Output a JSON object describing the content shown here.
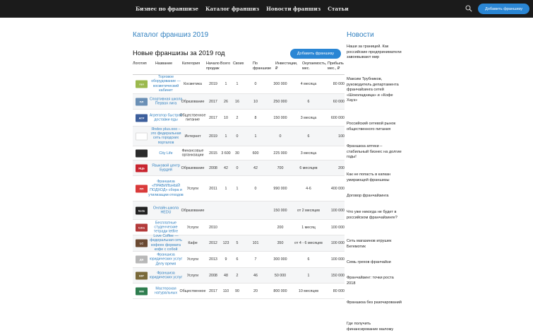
{
  "nav": {
    "links": [
      "Бизнес по франшизе",
      "Каталог франшиз",
      "Новости франшиз",
      "Статьи"
    ],
    "cta": "Добавить франшизу"
  },
  "page": {
    "title": "Каталог франшиз 2019",
    "section_title": "Новые франшизы за 2019 год",
    "add_button": "Добавить франшизу"
  },
  "table": {
    "headers": [
      "Логотип",
      "Название",
      "Категория",
      "Начало продаж",
      "Всего",
      "Своих",
      "По франшизе",
      "Инвестиции, ₽",
      "Окупаемость, мес.",
      "Прибыль мес., ₽"
    ],
    "rows": [
      {
        "logo": "гол",
        "logo_color": "#9bb94d",
        "name": "Торговое оборудование — косметический кабинет",
        "category": "Косметика",
        "start": "2019",
        "total": "1",
        "own": "1",
        "franchise": "0",
        "invest": "300 000",
        "payback": "4 месяца",
        "profit": "80 000"
      },
      {
        "logo": "ПЛ",
        "logo_color": "#6a8fb5",
        "name": "Спортивная школа Первая лига",
        "category": "Образование",
        "start": "2017",
        "total": "26",
        "own": "16",
        "franchise": "10",
        "invest": "250 000",
        "payback": "6",
        "profit": "60 000"
      },
      {
        "logo": "АГР",
        "logo_color": "#3d5f9c",
        "name": "Агрегатор быстрой доставки еды",
        "category": "Общественное питание",
        "start": "2017",
        "total": "10",
        "own": "2",
        "franchise": "8",
        "invest": "150 000",
        "payback": "3 месяца",
        "profit": "600 000"
      },
      {
        "logo": "",
        "logo_color": "#ffffff",
        "name": "Яndex plus.ooo – это федеральная сеть городских порталов",
        "category": "Интернет",
        "start": "2019",
        "total": "1",
        "own": "0",
        "franchise": "1",
        "invest": "0",
        "payback": "6",
        "profit": "100"
      },
      {
        "logo": "",
        "logo_color": "#2b2b2b",
        "name": "City Life",
        "category": "Финансовые организации",
        "start": "2015",
        "total": "3 600",
        "own": "30",
        "franchise": "600",
        "invest": "225 000",
        "payback": "3 месяца",
        "profit": ""
      },
      {
        "logo": "ЯЦБ",
        "logo_color": "#c8242f",
        "name": "Языковой центр Бурдей",
        "category": "Образование",
        "start": "2008",
        "total": "42",
        "own": "0",
        "franchise": "42",
        "invest": "700",
        "payback": "6 месяцев",
        "profit": "200"
      },
      {
        "logo": "ПП",
        "logo_color": "#d93a3a",
        "name": "Франшиза «ПРАВИЛЬНЫЙ ПОДХОД» сбора и утилизации отходов",
        "category": "Услуги",
        "start": "2011",
        "total": "1",
        "own": "1",
        "franchise": "0",
        "invest": "990 000",
        "payback": "4-6",
        "profit": "400 000"
      },
      {
        "logo": "hedu",
        "logo_color": "#222222",
        "name": "Онлайн-школа HEDU",
        "category": "Образование",
        "start": "",
        "total": "",
        "own": "",
        "franchise": "",
        "invest": "150 000",
        "payback": "от 2 месяцев",
        "profit": "100 000"
      },
      {
        "logo": "tetra",
        "logo_color": "#b33a3a",
        "name": "Бесплатные студенческие тетради tetfire",
        "category": "Услуги",
        "start": "2010",
        "total": "",
        "own": "",
        "franchise": "",
        "invest": "200",
        "payback": "1 месяц",
        "profit": "100 000"
      },
      {
        "logo": "LC",
        "logo_color": "#6b4a32",
        "name": "Love Coffee — федеральная сеть кофеен формата кофе с собой",
        "category": "Кафе",
        "start": "2012",
        "total": "123",
        "own": "5",
        "franchise": "101",
        "invest": "350",
        "payback": "от 4 - 6 месяцев",
        "profit": "100 000"
      },
      {
        "logo": "ДВ",
        "logo_color": "#b8b8b8",
        "name": "Франшиза юридических услуг Делу время",
        "category": "Услуги",
        "start": "2013",
        "total": "9",
        "own": "6",
        "franchise": "7",
        "invest": "300 000",
        "payback": "6",
        "profit": "100 000"
      },
      {
        "logo": "ЮР",
        "logo_color": "#7a6a3a",
        "name": "Франшиза юридических услуг",
        "category": "Услуги",
        "start": "2008",
        "total": "48",
        "own": "2",
        "franchise": "46",
        "invest": "50 000",
        "payback": "1",
        "profit": "150 000"
      },
      {
        "logo": "MM",
        "logo_color": "#2e7d4f",
        "name": "Мастерская натуральных",
        "category": "Общественное",
        "start": "2017",
        "total": "110",
        "own": "90",
        "franchise": "20",
        "invest": "800 000",
        "payback": "10 месяцев",
        "profit": "80 000"
      }
    ]
  },
  "news": {
    "title": "Новости",
    "items": [
      "Наши за границей. Как российские предприниматели завоевывают мир",
      "Максим Трубников, руководитель департамента франчайзинга сетей «Шоколадница» и «Кофе Хауз»",
      "Российский сетевой рынок общественного питания",
      "Франшиза аптеки – стабильный бизнес на долгие годы!",
      "Как не попасть в капкан умирающей франшизы",
      "Договор франчайзинга",
      "Что уже никогда не будет в российском франчайзинге?",
      "Сеть магазинов игрушек Бегемотик",
      "Семь грехов франчайзи",
      "Франчайзинг: точки роста 2018",
      "Франшиза без разочарований",
      "Где получить финансирование малому"
    ]
  }
}
